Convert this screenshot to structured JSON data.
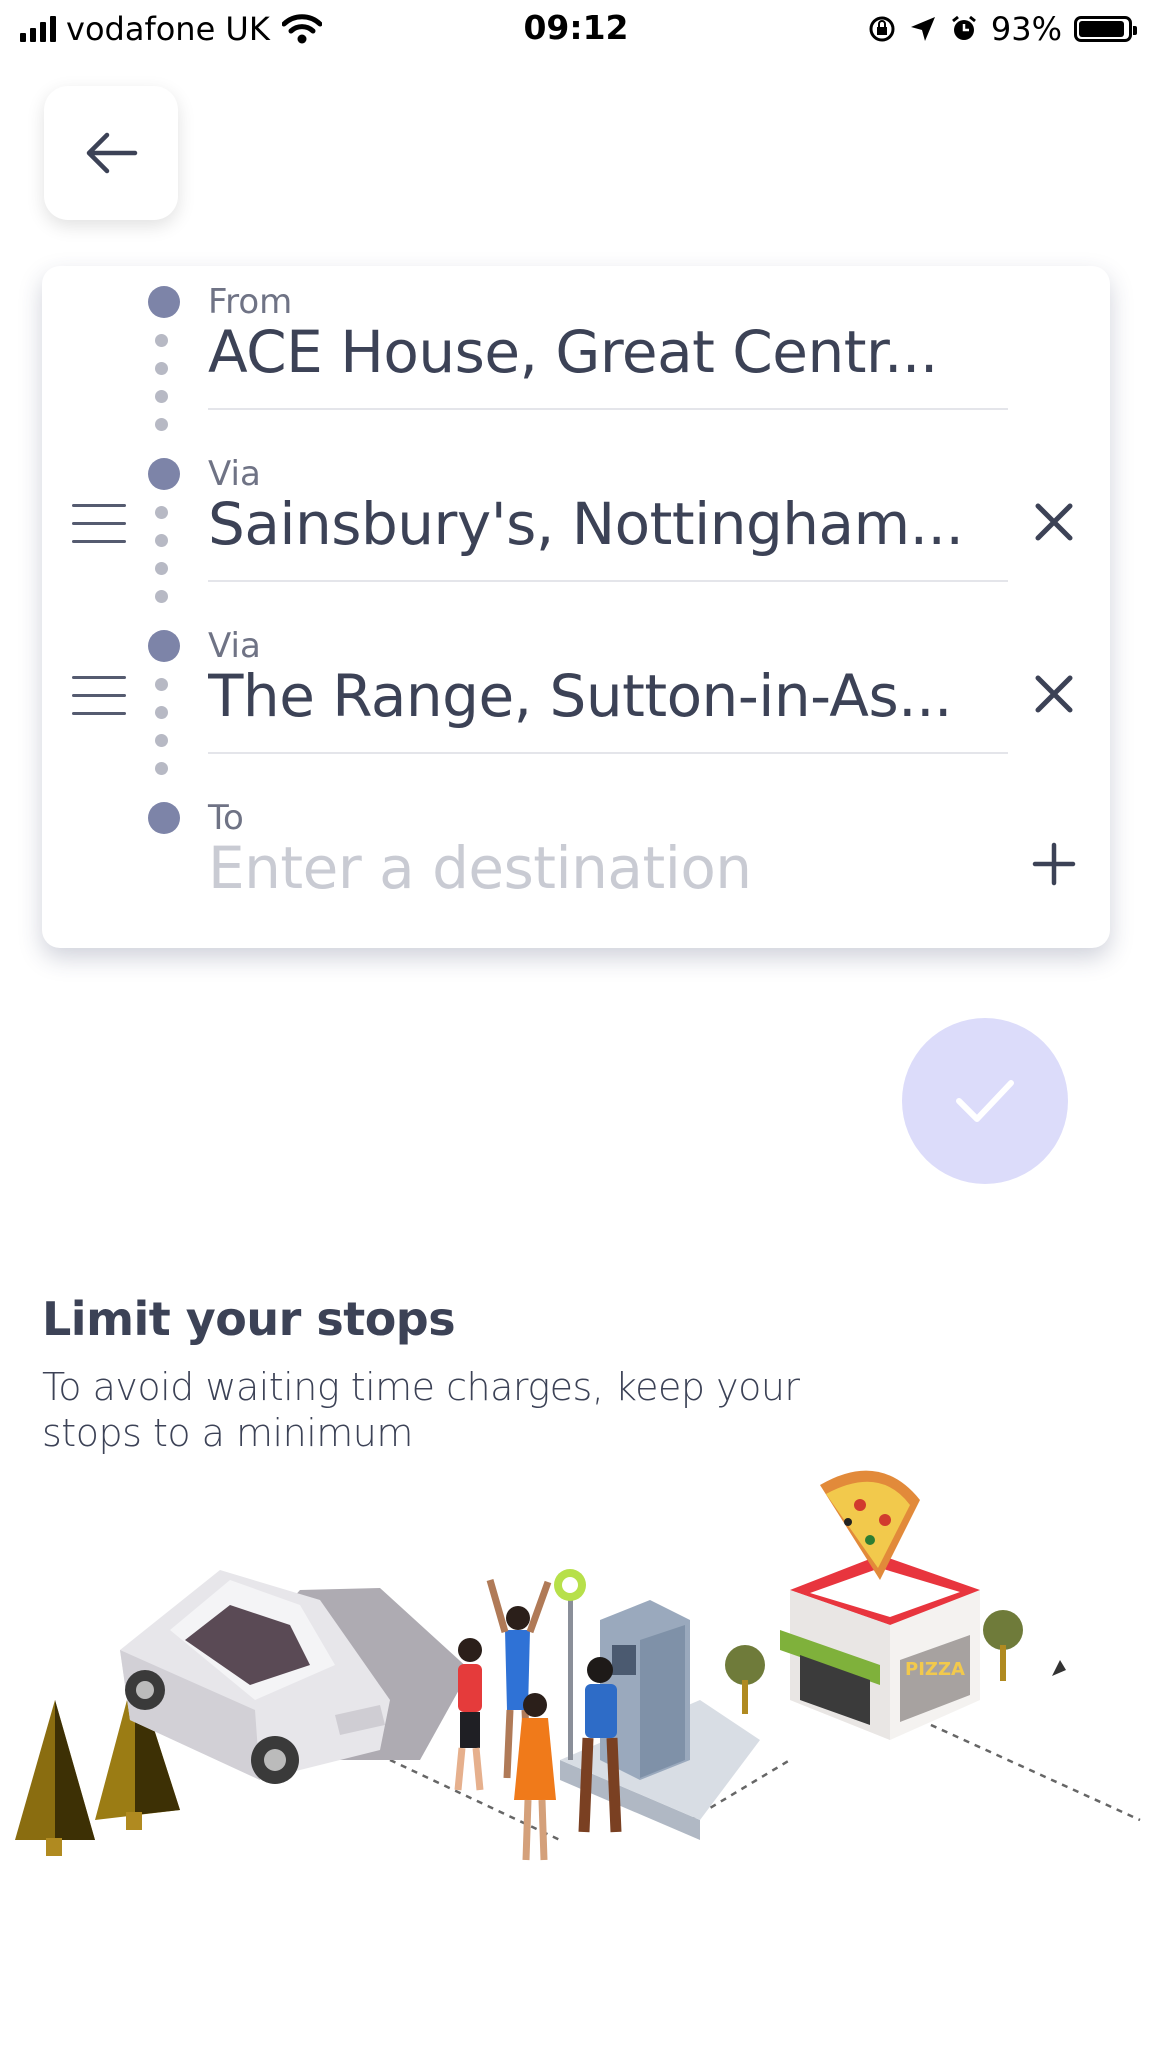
{
  "status_bar": {
    "carrier": "vodafone UK",
    "time": "09:12",
    "battery_percent": "93%",
    "battery_level": 0.93
  },
  "route": {
    "from": {
      "label": "From",
      "value": "ACE House, Great Centr..."
    },
    "vias": [
      {
        "label": "Via",
        "value": "Sainsbury's, Nottingham..."
      },
      {
        "label": "Via",
        "value": "The Range, Sutton-in-As..."
      }
    ],
    "to": {
      "label": "To",
      "placeholder": "Enter a destination"
    }
  },
  "tip": {
    "title": "Limit your stops",
    "body": "To avoid waiting time charges, keep your stops to a minimum"
  },
  "illustration": {
    "sign_text": "PIZZA"
  },
  "colors": {
    "dot": "#7d84a8",
    "text": "#3c4256",
    "confirm_bg": "#dcdcfa"
  }
}
